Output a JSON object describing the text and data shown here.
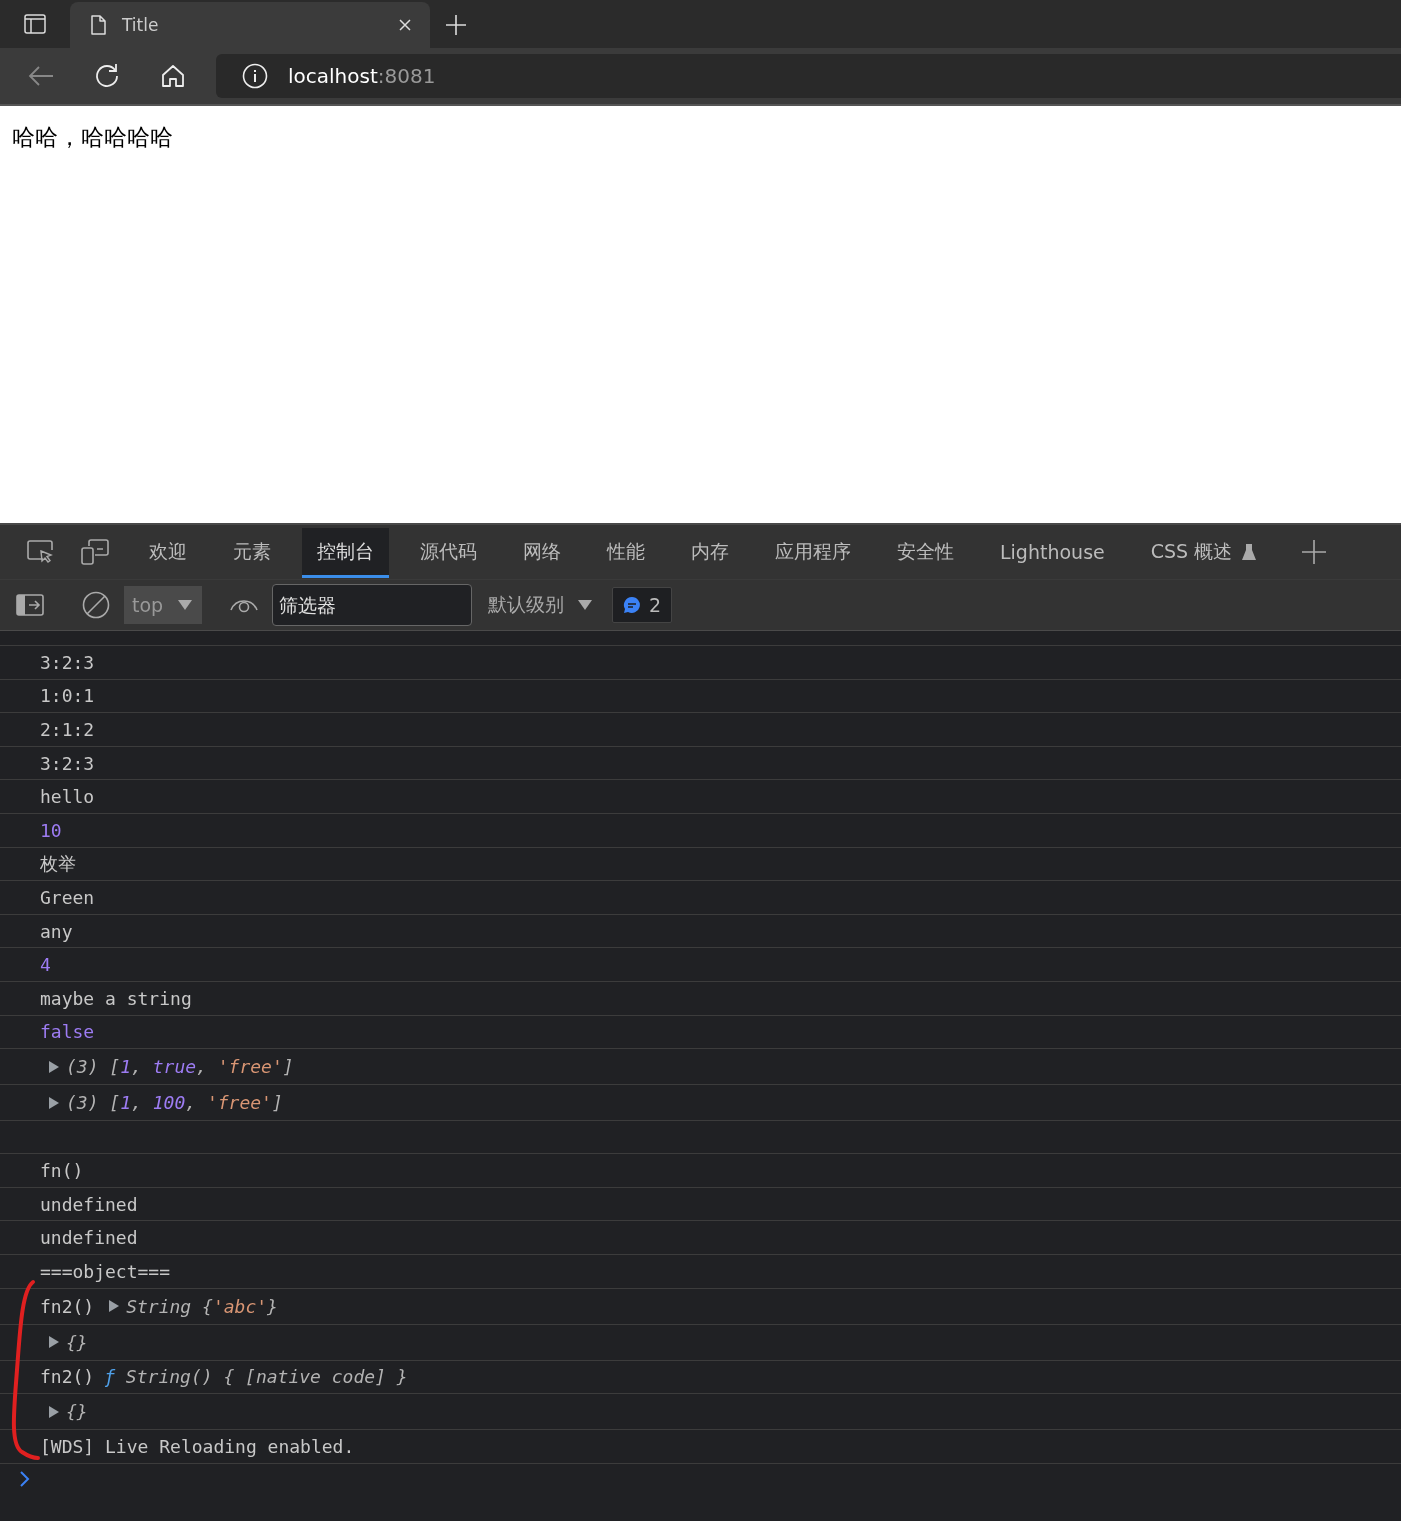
{
  "browser": {
    "tabs": [
      {
        "title": "Title",
        "selected": true
      }
    ],
    "back": {
      "disabled": true
    },
    "address": {
      "host": "localhost",
      "port": ":8081"
    }
  },
  "page": {
    "text": "哈哈，哈哈哈哈"
  },
  "devtools": {
    "tabs": [
      {
        "label": "欢迎",
        "selected": false,
        "experimental": false
      },
      {
        "label": "元素",
        "selected": false,
        "experimental": false
      },
      {
        "label": "控制台",
        "selected": true,
        "experimental": false
      },
      {
        "label": "源代码",
        "selected": false,
        "experimental": false
      },
      {
        "label": "网络",
        "selected": false,
        "experimental": false
      },
      {
        "label": "性能",
        "selected": false,
        "experimental": false
      },
      {
        "label": "内存",
        "selected": false,
        "experimental": false
      },
      {
        "label": "应用程序",
        "selected": false,
        "experimental": false
      },
      {
        "label": "安全性",
        "selected": false,
        "experimental": false
      },
      {
        "label": "Lighthouse",
        "selected": false,
        "experimental": false
      },
      {
        "label": "CSS 概述",
        "selected": false,
        "experimental": true
      }
    ],
    "toolbar": {
      "context": "top",
      "filter": {
        "placeholder": "筛选器"
      },
      "level": "默认级别",
      "message_count": "2"
    },
    "console": {
      "rows": [
        {
          "kind": "log",
          "tokens": [
            {
              "kind": "plain",
              "text": "3:2:3"
            }
          ]
        },
        {
          "kind": "log",
          "tokens": [
            {
              "kind": "plain",
              "text": "1:0:1"
            }
          ]
        },
        {
          "kind": "log",
          "tokens": [
            {
              "kind": "plain",
              "text": "2:1:2"
            }
          ]
        },
        {
          "kind": "log",
          "tokens": [
            {
              "kind": "plain",
              "text": "3:2:3"
            }
          ]
        },
        {
          "kind": "log",
          "tokens": [
            {
              "kind": "plain",
              "text": "hello"
            }
          ]
        },
        {
          "kind": "log",
          "tokens": [
            {
              "kind": "primitive",
              "text": "10"
            }
          ]
        },
        {
          "kind": "log",
          "tokens": [
            {
              "kind": "plain",
              "text": "枚举"
            }
          ]
        },
        {
          "kind": "log",
          "tokens": [
            {
              "kind": "plain",
              "text": "Green"
            }
          ]
        },
        {
          "kind": "log",
          "tokens": [
            {
              "kind": "plain",
              "text": "any"
            }
          ]
        },
        {
          "kind": "log",
          "tokens": [
            {
              "kind": "primitive",
              "text": "4"
            }
          ]
        },
        {
          "kind": "log",
          "tokens": [
            {
              "kind": "plain",
              "text": "maybe a string"
            }
          ]
        },
        {
          "kind": "log",
          "tokens": [
            {
              "kind": "primitive",
              "text": "false"
            }
          ]
        },
        {
          "kind": "log",
          "tokens": [
            {
              "kind": "object",
              "expanded": false,
              "parts": [
                {
                  "kind": "punct",
                  "text": "(3) ["
                },
                {
                  "kind": "primitive",
                  "text": "1"
                },
                {
                  "kind": "punct",
                  "text": ", "
                },
                {
                  "kind": "primitive",
                  "text": "true"
                },
                {
                  "kind": "punct",
                  "text": ", "
                },
                {
                  "kind": "string",
                  "text": "'free'"
                },
                {
                  "kind": "punct",
                  "text": "]"
                }
              ]
            }
          ]
        },
        {
          "kind": "log",
          "tokens": [
            {
              "kind": "object",
              "expanded": false,
              "parts": [
                {
                  "kind": "punct",
                  "text": "(3) ["
                },
                {
                  "kind": "primitive",
                  "text": "1"
                },
                {
                  "kind": "punct",
                  "text": ", "
                },
                {
                  "kind": "primitive",
                  "text": "100"
                },
                {
                  "kind": "punct",
                  "text": ", "
                },
                {
                  "kind": "string",
                  "text": "'free'"
                },
                {
                  "kind": "punct",
                  "text": "]"
                }
              ]
            }
          ]
        },
        {
          "kind": "blank"
        },
        {
          "kind": "log",
          "tokens": [
            {
              "kind": "plain",
              "text": "fn()"
            }
          ]
        },
        {
          "kind": "log",
          "tokens": [
            {
              "kind": "plain",
              "text": "undefined"
            }
          ]
        },
        {
          "kind": "log",
          "tokens": [
            {
              "kind": "plain",
              "text": "undefined"
            }
          ]
        },
        {
          "kind": "log",
          "tokens": [
            {
              "kind": "plain",
              "text": "===object==="
            }
          ]
        },
        {
          "kind": "log",
          "tokens": [
            {
              "kind": "plain",
              "text": "fn2()"
            },
            {
              "kind": "object",
              "expanded": false,
              "parts": [
                {
                  "kind": "punct",
                  "text": "String {"
                },
                {
                  "kind": "string",
                  "text": "'abc'"
                },
                {
                  "kind": "punct",
                  "text": "}"
                }
              ]
            }
          ]
        },
        {
          "kind": "log",
          "tokens": [
            {
              "kind": "object",
              "expanded": false,
              "parts": [
                {
                  "kind": "punct",
                  "text": "{}"
                }
              ]
            }
          ]
        },
        {
          "kind": "log",
          "tokens": [
            {
              "kind": "plain",
              "text": "fn2()"
            },
            {
              "kind": "function",
              "parts": [
                {
                  "kind": "fnmark",
                  "text": "ƒ"
                },
                {
                  "kind": "punct",
                  "text": " String() { [native code] }"
                }
              ]
            }
          ]
        },
        {
          "kind": "log",
          "tokens": [
            {
              "kind": "object",
              "expanded": false,
              "parts": [
                {
                  "kind": "punct",
                  "text": "{}"
                }
              ]
            }
          ]
        },
        {
          "kind": "log",
          "tokens": [
            {
              "kind": "plain",
              "text": "[WDS] Live Reloading enabled."
            }
          ]
        }
      ]
    }
  }
}
